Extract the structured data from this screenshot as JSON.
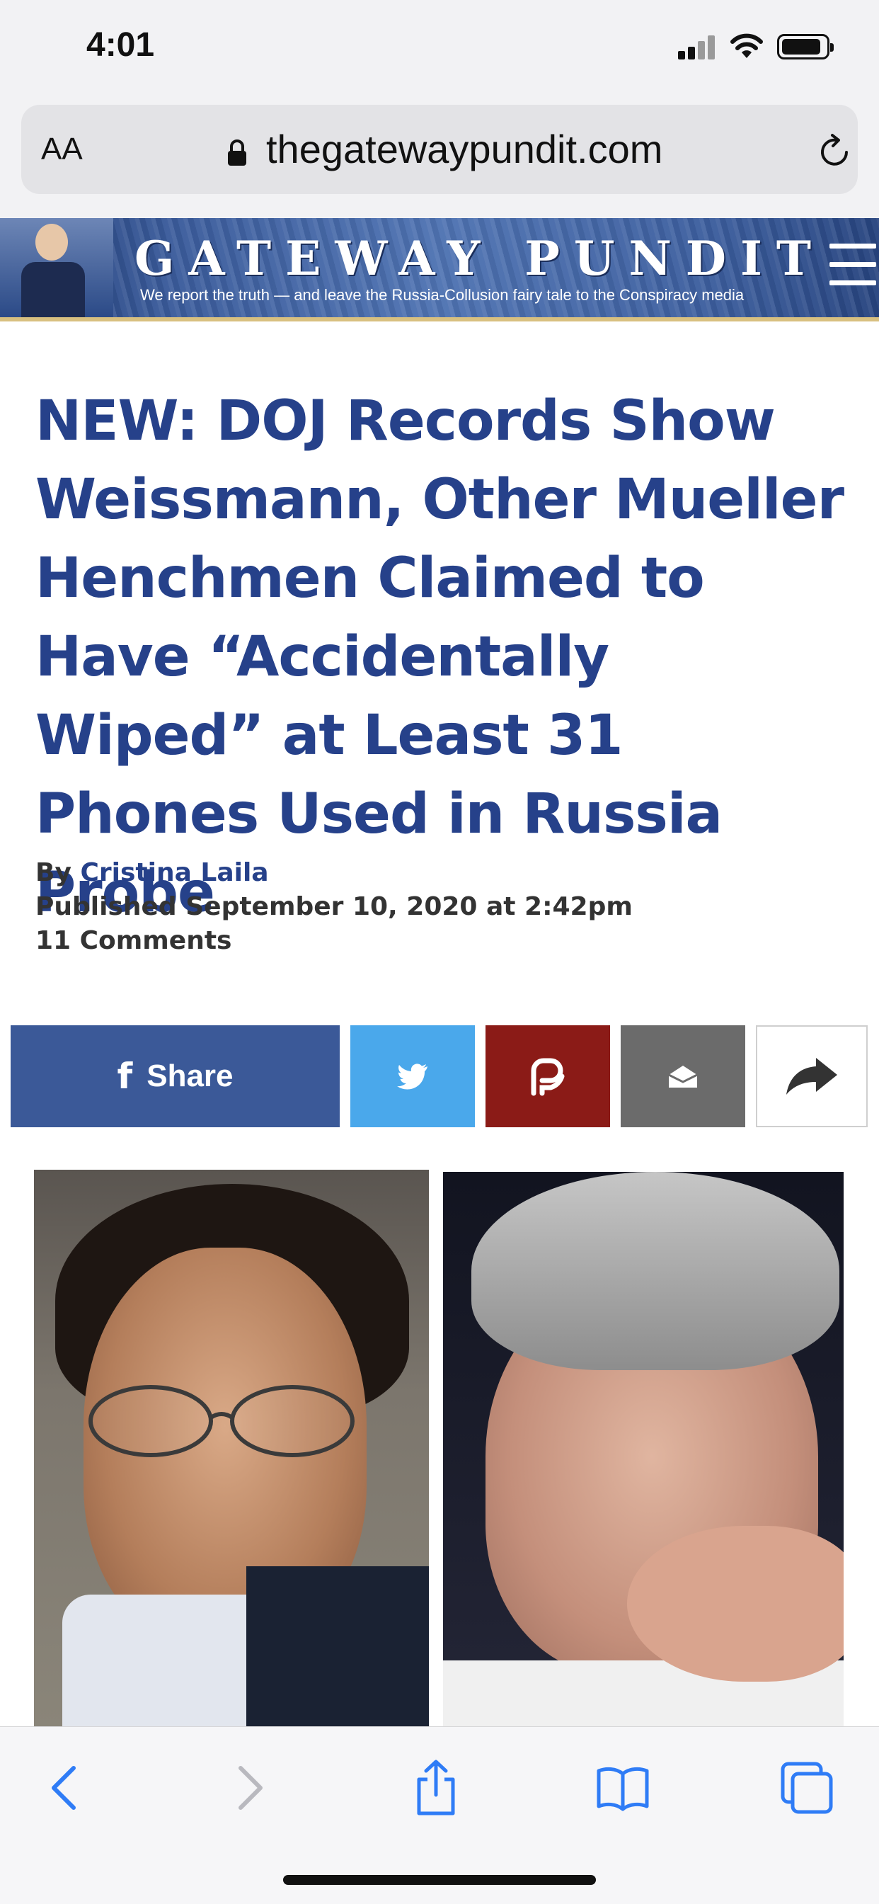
{
  "status_bar": {
    "time": "4:01"
  },
  "browser": {
    "text_size_label": "AA",
    "domain": "thegatewaypundit.com"
  },
  "site": {
    "title": "GATEWAY PUNDIT",
    "tagline": "We report the truth — and leave the Russia-Collusion fairy tale to the Conspiracy media",
    "colors": {
      "brand_blue": "#26418a",
      "gold_rule": "#d8c080"
    }
  },
  "article": {
    "headline": "NEW: DOJ Records Show Weissmann, Other Mueller Henchmen Claimed to Have “Accidentally Wiped” at Least 31 Phones Used in Russia Probe",
    "by_prefix": "By ",
    "author": "Cristina Laila",
    "published": "Published September 10, 2020 at 2:42pm",
    "comments": "11 Comments"
  },
  "share": {
    "facebook_label": "Share",
    "facebook_icon": "f",
    "colors": {
      "facebook": "#3b5998",
      "twitter": "#4aa8eb",
      "parler": "#8b1b17",
      "email": "#6b6b6b"
    }
  },
  "toolbar": {
    "icons": [
      "back-icon",
      "forward-icon",
      "share-icon",
      "bookmarks-icon",
      "tabs-icon"
    ]
  }
}
